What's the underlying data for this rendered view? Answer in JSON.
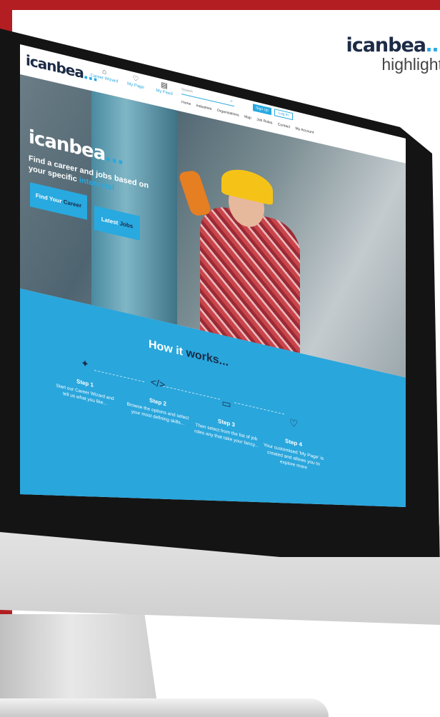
{
  "brand": {
    "logo_dark": "icanbea",
    "logo_blue": "…",
    "subtitle": "highlight"
  },
  "site": {
    "logo_dark": "icanbea",
    "logo_blue": "…",
    "nav": [
      {
        "label": "Career Wizard",
        "icon": "building-icon"
      },
      {
        "label": "My Page",
        "icon": "heart-icon"
      },
      {
        "label": "My Feed",
        "icon": "document-icon"
      }
    ],
    "search_placeholder": "Search",
    "sign_up": "Sign Up",
    "log_in": "Log In",
    "menu": [
      "Home",
      "Industries",
      "Organisations",
      "Map",
      "Job Roles",
      "Contact",
      "My Account"
    ]
  },
  "hero": {
    "logo_dark": "icanbea",
    "logo_blue": "…",
    "tagline_main": "Find a career and jobs based on your specific ",
    "tagline_highlight": "interests!",
    "btn_career_a": "Find Your ",
    "btn_career_b": "Career",
    "btn_jobs_a": "Latest ",
    "btn_jobs_b": "Jobs"
  },
  "how": {
    "title_a": "How it ",
    "title_b": "works...",
    "steps": [
      {
        "title": "Step 1",
        "desc": "Start our Career Wizard and tell us what you like...",
        "icon": "wizard-icon"
      },
      {
        "title": "Step 2",
        "desc": "Browse the options and select your most defining skills...",
        "icon": "code-icon"
      },
      {
        "title": "Step 3",
        "desc": "Then select from the list of job roles any that take your fancy...",
        "icon": "briefcase-icon"
      },
      {
        "title": "Step 4",
        "desc": "Your customised 'My Page' is created and allows you to explore more",
        "icon": "heart-icon"
      }
    ]
  }
}
